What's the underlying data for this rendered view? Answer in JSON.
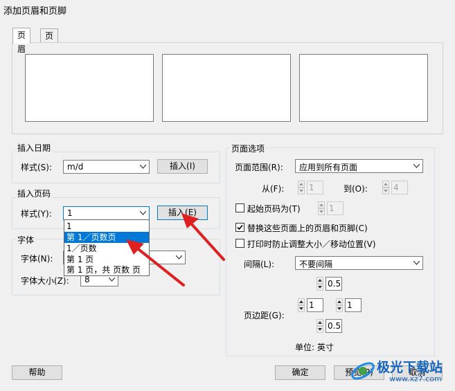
{
  "window": {
    "title": "添加页眉和页脚"
  },
  "tabs": {
    "header": "页眉",
    "footer": "页脚"
  },
  "insert_date": {
    "group_title": "插入日期",
    "style_label": "样式(S):",
    "style_value": "m/d",
    "insert_button": "插入(I)"
  },
  "insert_page": {
    "group_title": "插入页码",
    "style_label": "样式(Y):",
    "style_value": "1",
    "insert_button": "插入(E)",
    "dropdown_options": [
      "1",
      "第 1／页数页",
      "1／页数",
      "第 1 页",
      "第 1 页，共 页数 页"
    ],
    "selected_index": 1
  },
  "font": {
    "group_title": "字体",
    "font_label": "字体(N):",
    "size_label": "字体大小(Z):",
    "size_value": "8"
  },
  "page_options": {
    "group_title": "页面选项",
    "range_label": "页面范围(R):",
    "range_value": "应用到所有页面",
    "from_label": "从(F):",
    "from_value": "1",
    "to_label": "到(O):",
    "to_value": "4",
    "start_page_label": "起始页码为(T)",
    "start_page_checked": false,
    "start_page_value": "1",
    "replace_label": "替换这些页面上的页眉和页脚(C)",
    "replace_checked": true,
    "prevent_resize_label": "打印时防止调整大小／移动位置(V)",
    "prevent_resize_checked": false,
    "spacing_label": "间隔(L):",
    "spacing_value": "不要间隔",
    "spacing_num": "0.5",
    "margin_label": "页边距(G):",
    "margin_left": "1",
    "margin_right": "1",
    "margin_bottom": "0.5",
    "unit_label": "单位: 英寸"
  },
  "footer_buttons": {
    "help": "帮助",
    "ok": "确定",
    "preview": "预览(P)",
    "cancel": "取消"
  },
  "watermark": {
    "text": "极光下载站",
    "url": "www.xz7.com"
  },
  "colors": {
    "accent": "#0078d7",
    "arrow": "#e02020",
    "watermark": "#1565c0"
  }
}
